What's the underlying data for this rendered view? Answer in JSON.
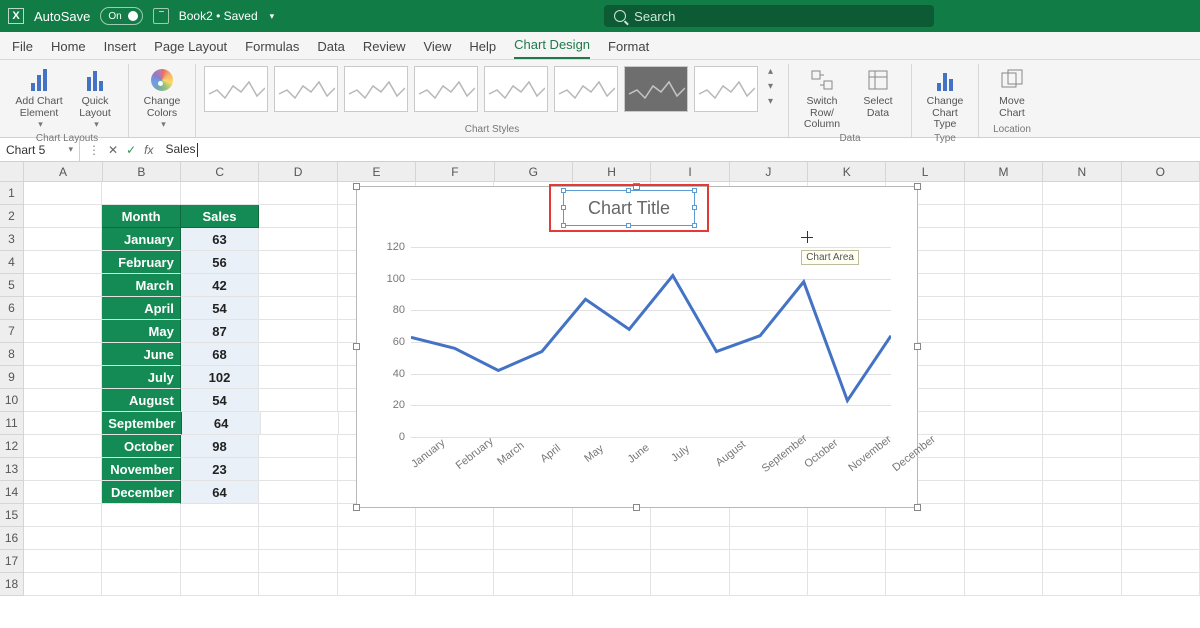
{
  "titlebar": {
    "autosave": "AutoSave",
    "autosave_state": "On",
    "doc": "Book2 • Saved"
  },
  "search": {
    "placeholder": "Search"
  },
  "tabs": [
    "File",
    "Home",
    "Insert",
    "Page Layout",
    "Formulas",
    "Data",
    "Review",
    "View",
    "Help",
    "Chart Design",
    "Format"
  ],
  "active_tab": "Chart Design",
  "ribbon": {
    "add_element": "Add Chart\nElement",
    "quick_layout": "Quick\nLayout",
    "change_colors": "Change\nColors",
    "switch_rowcol": "Switch Row/\nColumn",
    "select_data": "Select\nData",
    "change_type": "Change\nChart Type",
    "move_chart": "Move\nChart",
    "group_layouts": "Chart Layouts",
    "group_styles": "Chart Styles",
    "group_data": "Data",
    "group_type": "Type",
    "group_location": "Location"
  },
  "namebox": "Chart 5",
  "formula": "Sales",
  "columns": [
    "A",
    "B",
    "C",
    "D",
    "E",
    "F",
    "G",
    "H",
    "I",
    "J",
    "K",
    "L",
    "M",
    "N",
    "O"
  ],
  "table_headers": {
    "b": "Month",
    "c": "Sales"
  },
  "table_rows": [
    {
      "b": "January",
      "c": "63"
    },
    {
      "b": "February",
      "c": "56"
    },
    {
      "b": "March",
      "c": "42"
    },
    {
      "b": "April",
      "c": "54"
    },
    {
      "b": "May",
      "c": "87"
    },
    {
      "b": "June",
      "c": "68"
    },
    {
      "b": "July",
      "c": "102"
    },
    {
      "b": "August",
      "c": "54"
    },
    {
      "b": "September",
      "c": "64"
    },
    {
      "b": "October",
      "c": "98"
    },
    {
      "b": "November",
      "c": "23"
    },
    {
      "b": "December",
      "c": "64"
    }
  ],
  "chart_title": "Chart Title",
  "tooltip": "Chart Area",
  "chart_data": {
    "type": "line",
    "title": "Chart Title",
    "categories": [
      "January",
      "February",
      "March",
      "April",
      "May",
      "June",
      "July",
      "August",
      "September",
      "October",
      "November",
      "December"
    ],
    "values": [
      63,
      56,
      42,
      54,
      87,
      68,
      102,
      54,
      64,
      98,
      23,
      64
    ],
    "xlabel": "",
    "ylabel": "",
    "ylim": [
      0,
      120
    ],
    "yticks": [
      0,
      20,
      40,
      60,
      80,
      100,
      120
    ]
  }
}
